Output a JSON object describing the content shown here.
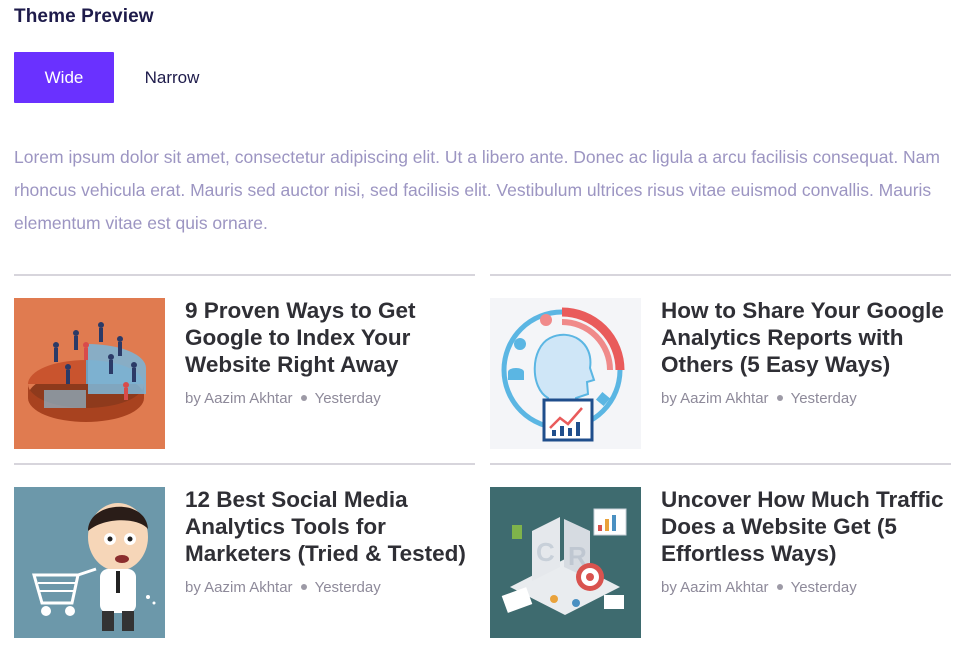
{
  "header": {
    "title": "Theme Preview"
  },
  "tabs": [
    {
      "label": "Wide",
      "active": true
    },
    {
      "label": "Narrow",
      "active": false
    }
  ],
  "intro_text": "Lorem ipsum dolor sit amet, consectetur adipiscing elit. Ut a libero ante. Donec ac ligula a arcu facilisis consequat. Nam rhoncus vehicula erat. Mauris sed auctor nisi, sed facilisis elit. Vestibulum ultrices risus vitae euismod convallis. Mauris elementum vitae est quis ornare.",
  "posts": [
    {
      "title": "9 Proven Ways to Get Google to Index Your Website Right Away",
      "author": "by Aazim Akhtar",
      "date": "Yesterday",
      "thumbnail": "pie-chart-people-illustration"
    },
    {
      "title": "How to Share Your Google Analytics Reports with Others (5 Easy Ways)",
      "author": "by Aazim Akhtar",
      "date": "Yesterday",
      "thumbnail": "head-analytics-illustration"
    },
    {
      "title": "12 Best Social Media Analytics Tools for Marketers (Tried & Tested)",
      "author": "by Aazim Akhtar",
      "date": "Yesterday",
      "thumbnail": "shopping-cart-cartoon-illustration"
    },
    {
      "title": "Uncover How Much Traffic Does a Website Get (5 Effortless Ways)",
      "author": "by Aazim Akhtar",
      "date": "Yesterday",
      "thumbnail": "cro-isometric-illustration"
    }
  ],
  "colors": {
    "accent": "#6a31ff",
    "title_text": "#1e1b4b",
    "intro_text": "#9c95c2",
    "divider": "#d7d5dc"
  }
}
